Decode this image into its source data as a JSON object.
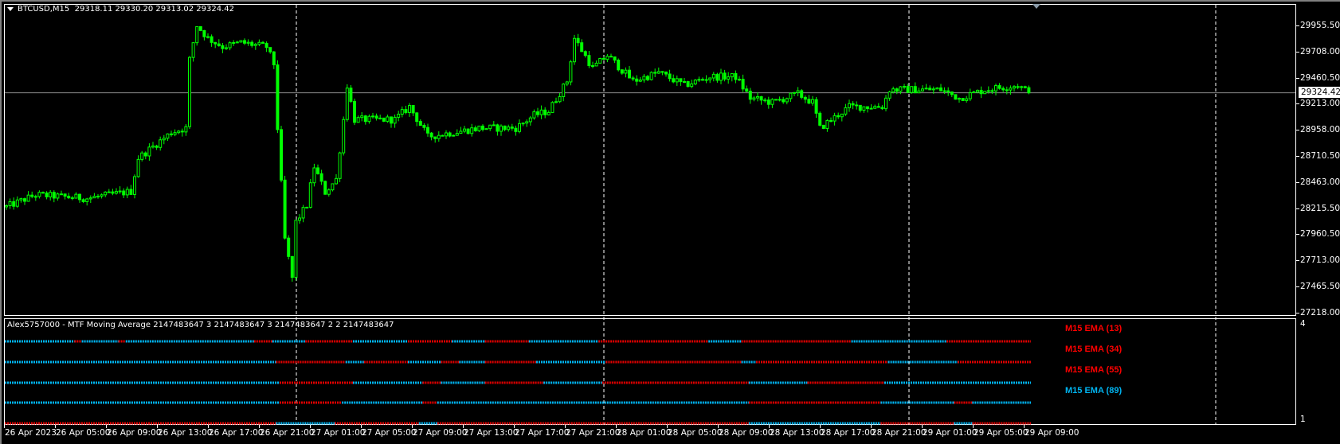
{
  "header": {
    "symbol": "BTCUSD,M15",
    "ohlc": "29318.11 29330.20 29313.02 29324.42"
  },
  "price_axis": {
    "ticks": [
      "29955.50",
      "29708.00",
      "29460.50",
      "29213.00",
      "28958.00",
      "28710.50",
      "28463.00",
      "28215.50",
      "27960.50",
      "27713.00",
      "27465.50",
      "27218.00"
    ],
    "current_price": "29324.42"
  },
  "time_axis": {
    "labels": [
      "26 Apr 2023",
      "26 Apr 05:00",
      "26 Apr 09:00",
      "26 Apr 13:00",
      "26 Apr 17:00",
      "26 Apr 21:00",
      "27 Apr 01:00",
      "27 Apr 05:00",
      "27 Apr 09:00",
      "27 Apr 13:00",
      "27 Apr 17:00",
      "27 Apr 21:00",
      "28 Apr 01:00",
      "28 Apr 05:00",
      "28 Apr 09:00",
      "28 Apr 13:00",
      "28 Apr 17:00",
      "28 Apr 21:00",
      "29 Apr 01:00",
      "29 Apr 05:00",
      "29 Apr 09:00"
    ]
  },
  "indicator": {
    "title": "Alex5757000 - MTF Moving Average 2147483647 3 2147483647 3 2147483647 2 2 2147483647",
    "scale_max": "4",
    "scale_min": "1",
    "labels": [
      {
        "text": "M15 EMA (13)",
        "color": "#ff0000"
      },
      {
        "text": "M15 EMA (34)",
        "color": "#ff0000"
      },
      {
        "text": "M15 EMA (55)",
        "color": "#ff0000"
      },
      {
        "text": "M15 EMA (89)",
        "color": "#00b4f0"
      }
    ],
    "colors": {
      "c": "#00b4f0",
      "r": "#e00000"
    },
    "rows": [
      [
        [
          "c",
          19
        ],
        [
          "r",
          2
        ],
        [
          "c",
          10
        ],
        [
          "r",
          2
        ],
        [
          "c",
          35
        ],
        [
          "r",
          5
        ],
        [
          "c",
          9
        ],
        [
          "r",
          13
        ],
        [
          "c",
          15
        ],
        [
          "r",
          12
        ],
        [
          "c",
          9
        ],
        [
          "r",
          12
        ],
        [
          "c",
          19
        ],
        [
          "r",
          30
        ],
        [
          "c",
          9
        ],
        [
          "r",
          30
        ],
        [
          "c",
          26
        ],
        [
          "r",
          23
        ]
      ],
      [
        [
          "c",
          74
        ],
        [
          "r",
          19
        ],
        [
          "c",
          5
        ],
        [
          "r",
          12
        ],
        [
          "c",
          9
        ],
        [
          "r",
          5
        ],
        [
          "c",
          7
        ],
        [
          "r",
          14
        ],
        [
          "c",
          19
        ],
        [
          "r",
          37
        ],
        [
          "c",
          4
        ],
        [
          "r",
          36
        ],
        [
          "c",
          19
        ],
        [
          "r",
          20
        ]
      ],
      [
        [
          "c",
          75
        ],
        [
          "r",
          20
        ],
        [
          "c",
          19
        ],
        [
          "r",
          5
        ],
        [
          "c",
          12
        ],
        [
          "r",
          16
        ],
        [
          "c",
          16
        ],
        [
          "r",
          40
        ],
        [
          "c",
          16
        ],
        [
          "r",
          21
        ],
        [
          "c",
          40
        ]
      ],
      [
        [
          "c",
          75
        ],
        [
          "r",
          17
        ],
        [
          "c",
          22
        ],
        [
          "r",
          4
        ],
        [
          "c",
          85
        ],
        [
          "r",
          36
        ],
        [
          "c",
          20
        ],
        [
          "r",
          5
        ],
        [
          "c",
          16
        ]
      ],
      [
        [
          "r",
          74
        ],
        [
          "c",
          16
        ],
        [
          "r",
          23
        ],
        [
          "c",
          5
        ],
        [
          "r",
          85
        ],
        [
          "c",
          36
        ],
        [
          "r",
          20
        ],
        [
          "c",
          5
        ],
        [
          "r",
          16
        ]
      ]
    ]
  },
  "chart_data": {
    "type": "candlestick",
    "bars": 280,
    "ylim": [
      27218,
      29955.5
    ],
    "candle_color": "#00ff00",
    "price_path": [
      [
        0,
        28243
      ],
      [
        8,
        28357
      ],
      [
        22,
        28324
      ],
      [
        34,
        28389
      ],
      [
        36,
        28706
      ],
      [
        45,
        28949
      ],
      [
        49,
        28990
      ],
      [
        50,
        29639
      ],
      [
        52,
        29963
      ],
      [
        55,
        29842
      ],
      [
        59,
        29761
      ],
      [
        64,
        29801
      ],
      [
        71,
        29761
      ],
      [
        73,
        29598
      ],
      [
        74,
        28990
      ],
      [
        76,
        27935
      ],
      [
        78,
        27570
      ],
      [
        79,
        28098
      ],
      [
        82,
        28260
      ],
      [
        84,
        28625
      ],
      [
        87,
        28381
      ],
      [
        90,
        28503
      ],
      [
        92,
        29071
      ],
      [
        93,
        29396
      ],
      [
        95,
        29071
      ],
      [
        106,
        29071
      ],
      [
        110,
        29193
      ],
      [
        115,
        28909
      ],
      [
        129,
        28990
      ],
      [
        139,
        28990
      ],
      [
        144,
        29112
      ],
      [
        148,
        29152
      ],
      [
        153,
        29436
      ],
      [
        155,
        29842
      ],
      [
        160,
        29558
      ],
      [
        164,
        29680
      ],
      [
        171,
        29436
      ],
      [
        178,
        29517
      ],
      [
        185,
        29396
      ],
      [
        192,
        29477
      ],
      [
        199,
        29477
      ],
      [
        203,
        29274
      ],
      [
        209,
        29233
      ],
      [
        216,
        29314
      ],
      [
        220,
        29233
      ],
      [
        222,
        28990
      ],
      [
        230,
        29193
      ],
      [
        239,
        29193
      ],
      [
        241,
        29355
      ],
      [
        255,
        29355
      ],
      [
        260,
        29274
      ],
      [
        267,
        29355
      ],
      [
        276,
        29396
      ],
      [
        279,
        29324.42
      ]
    ]
  }
}
